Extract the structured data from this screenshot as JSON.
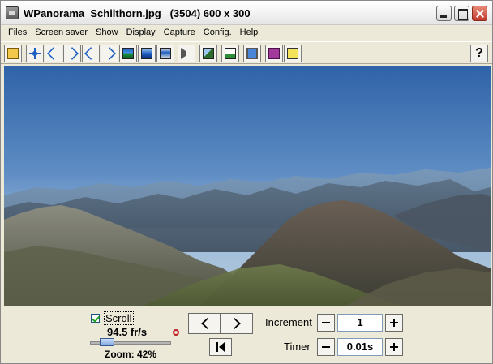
{
  "window": {
    "title": "WPanorama  Schilthorn.jpg   (3504) 600 x 300",
    "icons": {
      "app": "app-icon",
      "minimize": "minimize-icon",
      "maximize": "maximize-icon",
      "close": "close-icon"
    }
  },
  "menu": {
    "items": [
      "Files",
      "Screen saver",
      "Show",
      "Display",
      "Capture",
      "Config.",
      "Help"
    ]
  },
  "toolbar": {
    "buttons": [
      "open-folder-icon",
      "move-cross-icon",
      "arrow-left-up-icon",
      "arrow-right-up-icon",
      "arrow-left-down-icon",
      "arrow-right-down-icon",
      "panorama-icon",
      "panorama-blue-icon",
      "panorama-strip-icon",
      "sound-icon",
      "mountain-icon",
      "person-landscape-icon",
      "screen-icon",
      "book-icon",
      "help-picture-icon"
    ],
    "help_label": "?"
  },
  "controls": {
    "scroll_label": "Scroll",
    "scroll_checked": true,
    "speed": "94.5 fr/s",
    "zoom": "Zoom: 42%",
    "zoom_fraction": 0.42,
    "increment_label": "Increment",
    "increment_value": "1",
    "timer_label": "Timer",
    "timer_value": "0.01s"
  },
  "colors": {
    "window_bg": "#ece9d8",
    "sky_top": "#2f63a8",
    "sky_horizon": "#a9c3dc",
    "close_button": "#c1392b"
  }
}
